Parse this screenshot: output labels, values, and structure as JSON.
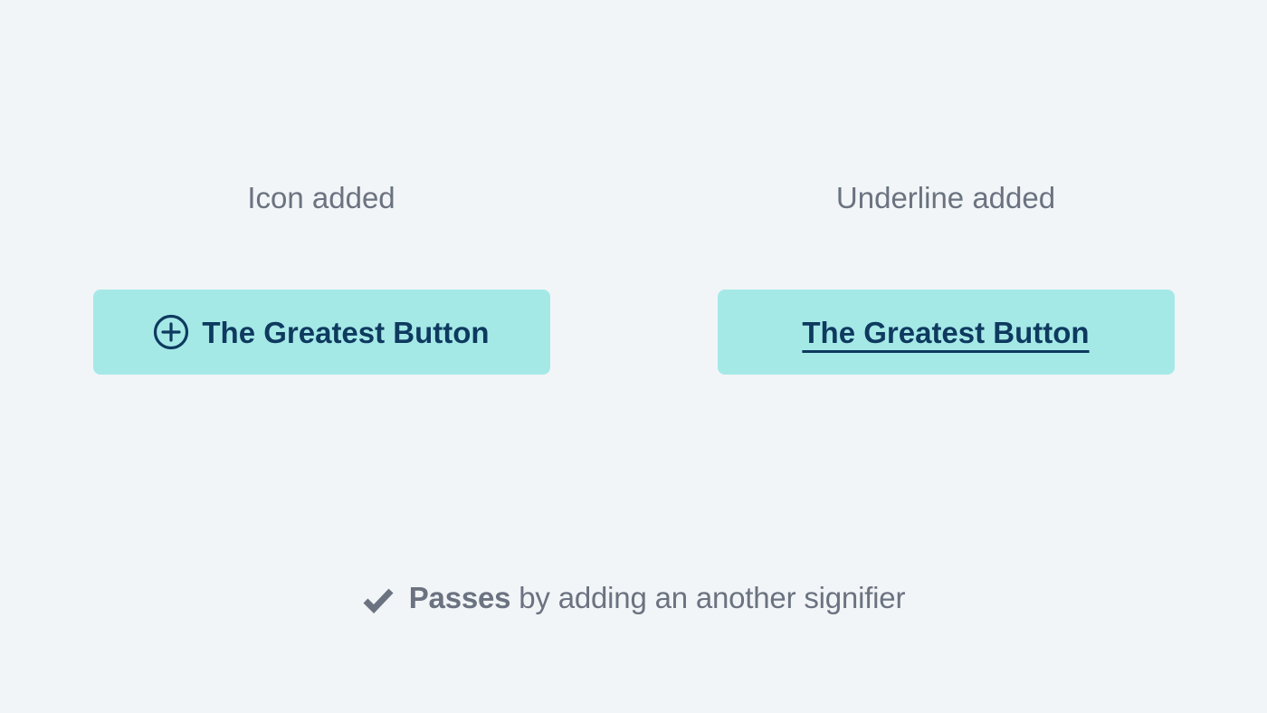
{
  "columns": {
    "left": {
      "label": "Icon added",
      "button_label": "The Greatest Button"
    },
    "right": {
      "label": "Underline added",
      "button_label": "The Greatest Button"
    }
  },
  "footer": {
    "bold": "Passes",
    "rest": " by adding an another signifier"
  },
  "colors": {
    "background": "#f1f5f7",
    "button_bg": "#a5e9e7",
    "button_text": "#0e3a5f",
    "muted_text": "#6b7280"
  }
}
